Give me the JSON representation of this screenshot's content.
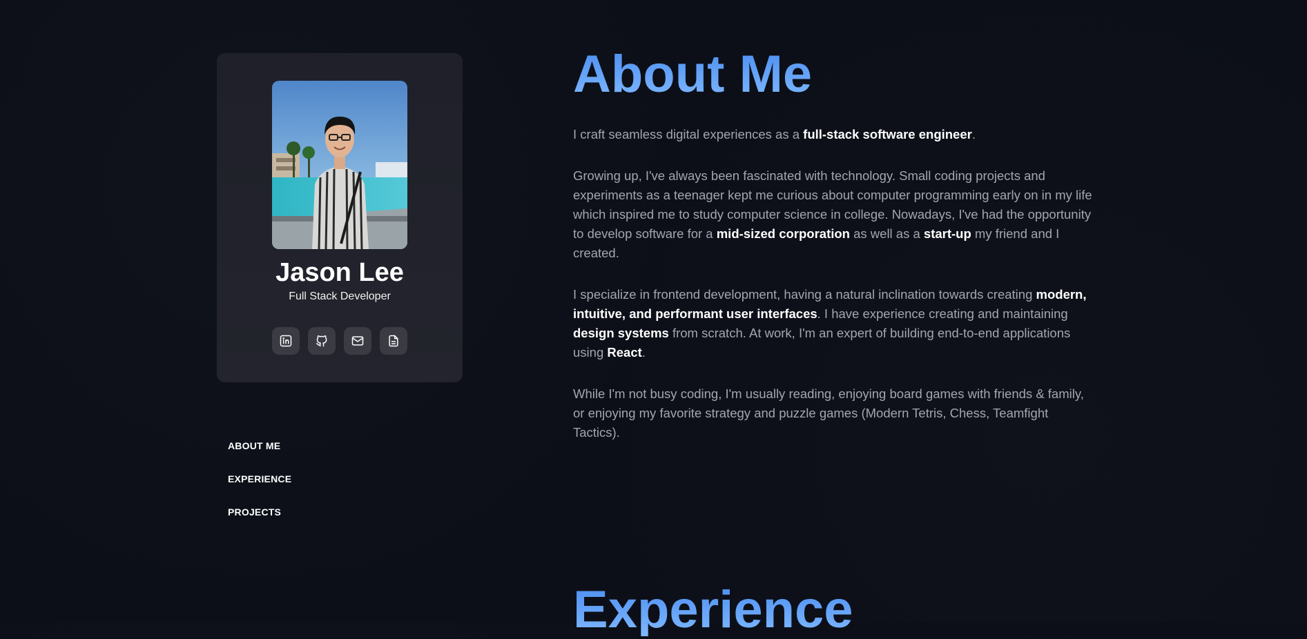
{
  "profile": {
    "name": "Jason Lee",
    "role": "Full Stack Developer",
    "socials": [
      {
        "icon": "linkedin-icon"
      },
      {
        "icon": "github-icon"
      },
      {
        "icon": "mail-icon"
      },
      {
        "icon": "document-icon"
      }
    ]
  },
  "nav": {
    "about": "ABOUT ME",
    "experience": "EXPERIENCE",
    "projects": "PROJECTS"
  },
  "about": {
    "title": "About Me",
    "p1": {
      "a": "I craft seamless digital experiences as a ",
      "b": "full-stack software engineer",
      "c": "."
    },
    "p2": {
      "a": "Growing up, I've always been fascinated with technology. Small coding projects and experiments as a teenager kept me curious about computer programming early on in my life which inspired me to study computer science in college. Nowadays, I've had the opportunity to develop software for a ",
      "b": "mid-sized corporation",
      "c": " as well as a ",
      "d": "start-up",
      "e": " my friend and I created."
    },
    "p3": {
      "a": "I specialize in frontend development, having a natural inclination towards creating ",
      "b": "modern, intuitive, and performant user interfaces",
      "c": ". I have experience creating and maintaining ",
      "d": "design systems",
      "e": " from scratch. At work, I'm an expert of building end-to-end applications using ",
      "f": "React",
      "g": "."
    },
    "p4": "While I'm not busy coding, I'm usually reading, enjoying board games with friends & family, or enjoying my favorite strategy and puzzle games (Modern Tetris, Chess, Teamfight Tactics)."
  },
  "experience": {
    "title": "Experience"
  },
  "colors": {
    "background": "#0c0f18",
    "card": "#22232b",
    "accent": "#62a3f8",
    "text": "#a3a6ae",
    "emphasis": "#ffffff"
  }
}
